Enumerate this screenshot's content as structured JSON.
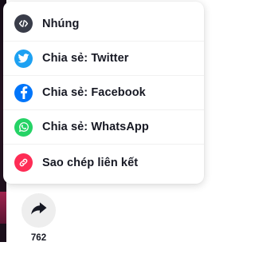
{
  "share_menu": {
    "items": [
      {
        "label": "Nhúng",
        "icon": "embed-icon",
        "color": "#393c49"
      },
      {
        "label": "Chia sẻ: Twitter",
        "icon": "twitter-icon",
        "color": "#1da1f2"
      },
      {
        "label": "Chia sẻ: Facebook",
        "icon": "facebook-icon",
        "color": "#0075fa"
      },
      {
        "label": "Chia sẻ: WhatsApp",
        "icon": "whatsapp-icon",
        "color": "#25d366"
      },
      {
        "label": "Sao chép liên kết",
        "icon": "link-icon",
        "color": "#fe2c55"
      }
    ]
  },
  "share_button": {
    "icon": "share-arrow-icon",
    "count": "762"
  }
}
